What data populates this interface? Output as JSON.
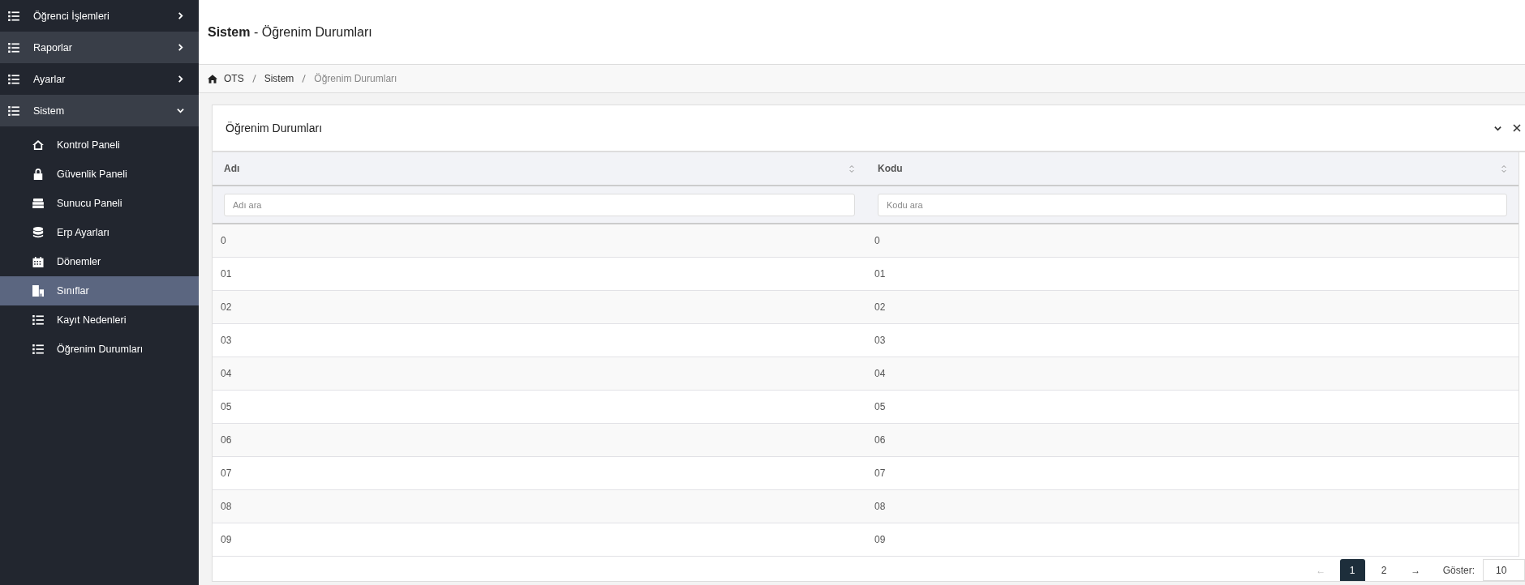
{
  "sidebar": {
    "items": [
      {
        "label": "Öğrenci İşlemleri",
        "highlighted": false,
        "expanded": false
      },
      {
        "label": "Raporlar",
        "highlighted": true,
        "expanded": false
      },
      {
        "label": "Ayarlar",
        "highlighted": false,
        "expanded": false
      },
      {
        "label": "Sistem",
        "highlighted": true,
        "expanded": true,
        "children": [
          {
            "label": "Kontrol Paneli",
            "selected": false
          },
          {
            "label": "Güvenlik Paneli",
            "selected": false
          },
          {
            "label": "Sunucu Paneli",
            "selected": false
          },
          {
            "label": "Erp Ayarları",
            "selected": false
          },
          {
            "label": "Dönemler",
            "selected": false
          },
          {
            "label": "Sınıflar",
            "selected": true
          },
          {
            "label": "Kayıt Nedenleri",
            "selected": false
          },
          {
            "label": "Öğrenim Durumları",
            "selected": false
          }
        ]
      }
    ]
  },
  "page_title": {
    "section": "Sistem",
    "page": "- Öğrenim Durumları"
  },
  "breadcrumb": [
    {
      "label": "OTS",
      "current": false
    },
    {
      "label": "Sistem",
      "current": false
    },
    {
      "label": "Öğrenim Durumları",
      "current": true
    }
  ],
  "card": {
    "title": "Öğrenim Durumları",
    "table": {
      "columns": [
        {
          "label": "Adı",
          "placeholder": "Adı ara"
        },
        {
          "label": "Kodu",
          "placeholder": "Kodu ara"
        }
      ],
      "rows": [
        [
          "0",
          "0"
        ],
        [
          "01",
          "01"
        ],
        [
          "02",
          "02"
        ],
        [
          "03",
          "03"
        ],
        [
          "04",
          "04"
        ],
        [
          "05",
          "05"
        ],
        [
          "06",
          "06"
        ],
        [
          "07",
          "07"
        ],
        [
          "08",
          "08"
        ],
        [
          "09",
          "09"
        ]
      ]
    }
  },
  "pagination": {
    "prev": {
      "label": "←",
      "disabled": true
    },
    "pages": [
      {
        "label": "1",
        "selected": true
      },
      {
        "label": "2",
        "selected": false
      }
    ],
    "next": {
      "label": "→",
      "disabled": false
    },
    "page_size_label": "Göster:",
    "page_size": "10"
  }
}
